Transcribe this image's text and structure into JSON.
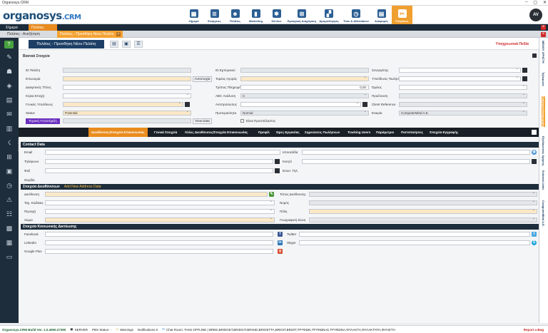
{
  "window": {
    "title": "Organosys.CRM",
    "controls": [
      "–",
      "▢",
      "✕"
    ]
  },
  "logo": {
    "main": "organosys",
    "suffix": ".CRM"
  },
  "menu": [
    {
      "label": "Σήμερα",
      "icon": "calendar-icon",
      "glyph": "▦"
    },
    {
      "label": "Ενέργειες",
      "icon": "list-icon",
      "glyph": "≣"
    },
    {
      "label": "Πελάτες",
      "icon": "users-icon",
      "glyph": "☻"
    },
    {
      "label": "Marketing",
      "icon": "chart-icon",
      "glyph": "▮"
    },
    {
      "label": "Service",
      "icon": "gear-icon",
      "glyph": "✱"
    },
    {
      "label": "Εμπορική Διαχείριση",
      "icon": "cart-icon",
      "glyph": "⊞"
    },
    {
      "label": "Δρομολόγηση",
      "icon": "map-icon",
      "glyph": "▞"
    },
    {
      "label": "Time & Attendance",
      "icon": "clock-icon",
      "glyph": "◷"
    },
    {
      "label": "Αναφορές",
      "icon": "report-icon",
      "glyph": "▤"
    },
    {
      "label": "Ρυθμίσεις",
      "icon": "tools-icon",
      "glyph": "✂"
    }
  ],
  "user": {
    "initials": "AV"
  },
  "tabs_top": {
    "first": "Σήμερα",
    "second": "Πελάτες"
  },
  "tabs_sub": {
    "first": "Πελάτες - Αναζήτηση",
    "second": "Πελάτες - Προσθήκη Νέου Πελάτη"
  },
  "page": {
    "title": "Πελάτες - Προσθήκη Νέου Πελάτη",
    "required_label": "Υποχρεωτικά Πεδία",
    "section_basic": "Βασικά Στοιχεία"
  },
  "form": {
    "col1": {
      "id": "ID Πελάτη",
      "company": "Επωνυμία",
      "trade_name": "Διακριτικός Τίτλος",
      "main_activity": "Κύρια Εποχή",
      "general_manager": "Γενικός Υπεύθυνος",
      "status": "Status",
      "status_value": "Potential",
      "tech_support": "Τεχνική Υποστήριξη",
      "check_btn": "Αντιστοιχία",
      "view_btn": "View Data"
    },
    "col2": {
      "erp_id": "ID Εμπορικού",
      "market_segment": "Τομέας Αγοράς",
      "payment": "Τρόπος Πληρωμής",
      "payment_value": "0,00",
      "abc": "ABC Ανάλυση",
      "abc_value": "C",
      "agent": "Αντιπρόσωπος",
      "priority": "Προτεραιότητα",
      "priority_value": "Normal",
      "is_prospect": "Είναι Προσπέλαστος"
    },
    "col3": {
      "partner": "Συνεργάτης",
      "salesman": "Υπεύθυνος Πωλήσεων",
      "group": "Όμιλος",
      "source": "Προέλευση",
      "client_ref": "Client Reference",
      "company": "Εταιρία",
      "company_value": "ComputerMind A.E."
    }
  },
  "subtabs": [
    "Διευθύνσεις/Στοιχεία Επικοινωνίας",
    "Γενικά Στοιχεία",
    "Άλλες Διευθύνσεις/Στοιχεία Επικοινωνίας",
    "Προφίλ",
    "Ώρες Εργασίας",
    "Σημειώσεις Πωλήσεων",
    "Tracking Users",
    "Παράμετροι",
    "Πιστοποιήσεις",
    "Στοιχεία Εγγραφής"
  ],
  "contact": {
    "title": "Contact Data",
    "email": "Email",
    "phone": "Τηλέφωνο",
    "fax": "Φαξ",
    "phone_notes": "Θυρίδα",
    "website": "Ιστοσελίδα",
    "mobile": "Κινητό",
    "ext": "Εσωτ. Τηλ."
  },
  "address": {
    "title": "Στοιχεία Διευθύνσεων",
    "add": "Add New Address Data",
    "street": "Διεύθυνση",
    "zip": "Ταχ. Κώδικας",
    "area": "Περιοχή",
    "country": "Χώρα",
    "address_type": "Τύπος Διεύθυνσης",
    "prefecture": "Νομός",
    "city": "Πόλη",
    "geo_zone": "Γεωγραφική Ζώνη"
  },
  "social": {
    "title": "Στοιχεία Κοινωνικής Δικτύωσης",
    "facebook": "Facebook",
    "linkedin": "LinkedIn",
    "googleplus": "Google Plus",
    "twitter": "Twitter",
    "skype": "Skype"
  },
  "sidebar_label": "ΣΗΜΕΡΑ",
  "rightstrip": [
    "ΜΕΝΟΥ ΧΡΗΣΤΗ",
    "Τηλέφωνα",
    "Γρήγορη Καταχώρηση",
    "Εξειδικεύσεις Χρήστη",
    "External Links",
    "ComputerMind A.E."
  ],
  "status": {
    "build": "Organosys.CRM Build Ver. 1.0.4060.27390",
    "server": "SERVER",
    "pbx": "PBX Status: -",
    "warnings": "Warnings",
    "notifications": "Notifications 0",
    "chat": "Chat Room: TAK5 OFFLINE | BREE,BRIDGET,BRIDGIT,BRISID,BRIGETTA,BRIGIT,BRIZIT,ΤΡΥΦΩΝ,ΤΡΥΦΩΝΑΣ,ΤΡΥΦΩΝΑ,ΦΥΛΑΚΤΑ,ΦΥΛΑΚΤΑΤΗ,ΦΥΛΙΣΤΗ",
    "bug": "Report a Bug"
  }
}
